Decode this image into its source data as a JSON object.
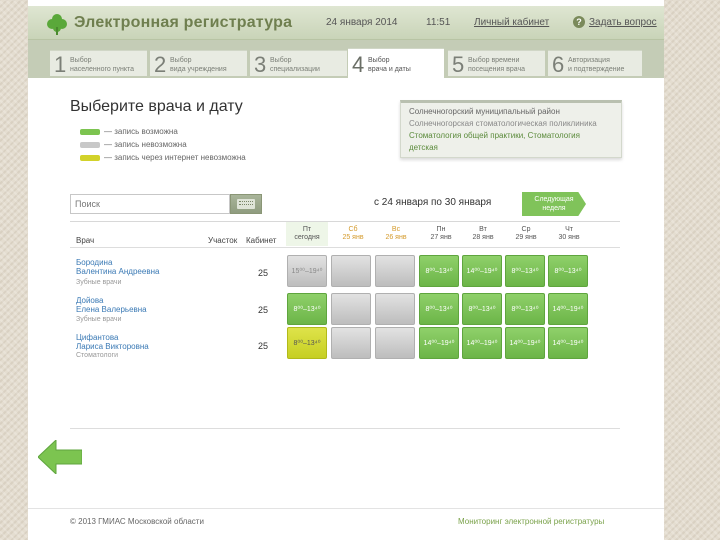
{
  "header": {
    "app_title": "Электронная регистратура",
    "date": "24 января 2014",
    "time": "11:51",
    "cabinet": "Личный кабинет",
    "ask": "Задать вопрос"
  },
  "steps": [
    {
      "num": "1",
      "line1": "Выбор",
      "line2": "населенного пункта"
    },
    {
      "num": "2",
      "line1": "Выбор",
      "line2": "вида учреждения"
    },
    {
      "num": "3",
      "line1": "Выбор",
      "line2": "специализации"
    },
    {
      "num": "4",
      "line1": "Выбор",
      "line2": "врача и даты"
    },
    {
      "num": "5",
      "line1": "Выбор времени",
      "line2": "посещения врача"
    },
    {
      "num": "6",
      "line1": "Авторизация",
      "line2": "и подтверждение"
    }
  ],
  "main": {
    "title": "Выберите врача и дату",
    "legend": [
      {
        "color": "#7cc450",
        "text": "— запись возможна"
      },
      {
        "color": "#c8c8c8",
        "text": "— запись невозможна"
      },
      {
        "color": "#d2d22a",
        "text": "— запись через интернет невозможна"
      }
    ]
  },
  "info": {
    "line1": "Солнечногорский муниципальный район",
    "line2": "Солнечногорская стоматологическая поликлиника",
    "line3": "Стоматология общей практики, Стоматология",
    "line4": "детская"
  },
  "search": {
    "placeholder": "Поиск"
  },
  "range": "с 24 января по 30 января",
  "next_week": {
    "line1": "Следующая",
    "line2": "неделя"
  },
  "columns": {
    "doctor": "Врач",
    "area": "Участок",
    "room": "Кабинет"
  },
  "days": [
    {
      "dow": "Пт",
      "date": "сегодня",
      "kind": "today"
    },
    {
      "dow": "Сб",
      "date": "25 янв",
      "kind": "weekend"
    },
    {
      "dow": "Вс",
      "date": "26 янв",
      "kind": "weekend"
    },
    {
      "dow": "Пн",
      "date": "27 янв",
      "kind": "normal"
    },
    {
      "dow": "Вт",
      "date": "28 янв",
      "kind": "normal"
    },
    {
      "dow": "Ср",
      "date": "29 янв",
      "kind": "normal"
    },
    {
      "dow": "Чт",
      "date": "30 янв",
      "kind": "normal"
    }
  ],
  "doctors": [
    {
      "name1": "Бородина",
      "name2": "Валентина Андреевна",
      "spec": "Зубные врачи",
      "room": "25",
      "cells": [
        {
          "status": "gray",
          "time": "15⁰⁰–19⁴⁰"
        },
        {
          "status": "gray",
          "time": ""
        },
        {
          "status": "gray",
          "time": ""
        },
        {
          "status": "green",
          "time": "8⁰⁰–13⁴⁰"
        },
        {
          "status": "green",
          "time": "14⁰⁰–19⁴⁰"
        },
        {
          "status": "green",
          "time": "8⁰⁰–13⁴⁰"
        },
        {
          "status": "green",
          "time": "8⁰⁰–13⁴⁰"
        }
      ]
    },
    {
      "name1": "Дойова",
      "name2": "Елена Валерьевна",
      "spec": "Зубные врачи",
      "room": "25",
      "cells": [
        {
          "status": "green",
          "time": "8⁰⁰–13⁴⁰"
        },
        {
          "status": "gray",
          "time": ""
        },
        {
          "status": "gray",
          "time": ""
        },
        {
          "status": "green",
          "time": "8⁰⁰–13⁴⁰"
        },
        {
          "status": "green",
          "time": "8⁰⁰–13⁴⁰"
        },
        {
          "status": "green",
          "time": "8⁰⁰–13⁴⁰"
        },
        {
          "status": "green",
          "time": "14⁰⁰–19⁴⁰"
        }
      ]
    },
    {
      "name1": "Цифантова",
      "name2": "Лариса Викторовна",
      "spec": "Стоматологи",
      "room": "25",
      "cells": [
        {
          "status": "yellow",
          "time": "8⁰⁰–13⁴⁰"
        },
        {
          "status": "gray",
          "time": ""
        },
        {
          "status": "gray",
          "time": ""
        },
        {
          "status": "green",
          "time": "14⁰⁰–19⁴⁰"
        },
        {
          "status": "green",
          "time": "14⁰⁰–19⁴⁰"
        },
        {
          "status": "green",
          "time": "14⁰⁰–19⁴⁰"
        },
        {
          "status": "green",
          "time": "14⁰⁰–19⁴⁰"
        }
      ]
    }
  ],
  "footer": {
    "copy": "© 2013 ГМИАС Московской области",
    "link": "Мониторинг электронной регистратуры"
  },
  "colors": {
    "accent": "#7cc450",
    "brand": "#6f7f4f"
  }
}
